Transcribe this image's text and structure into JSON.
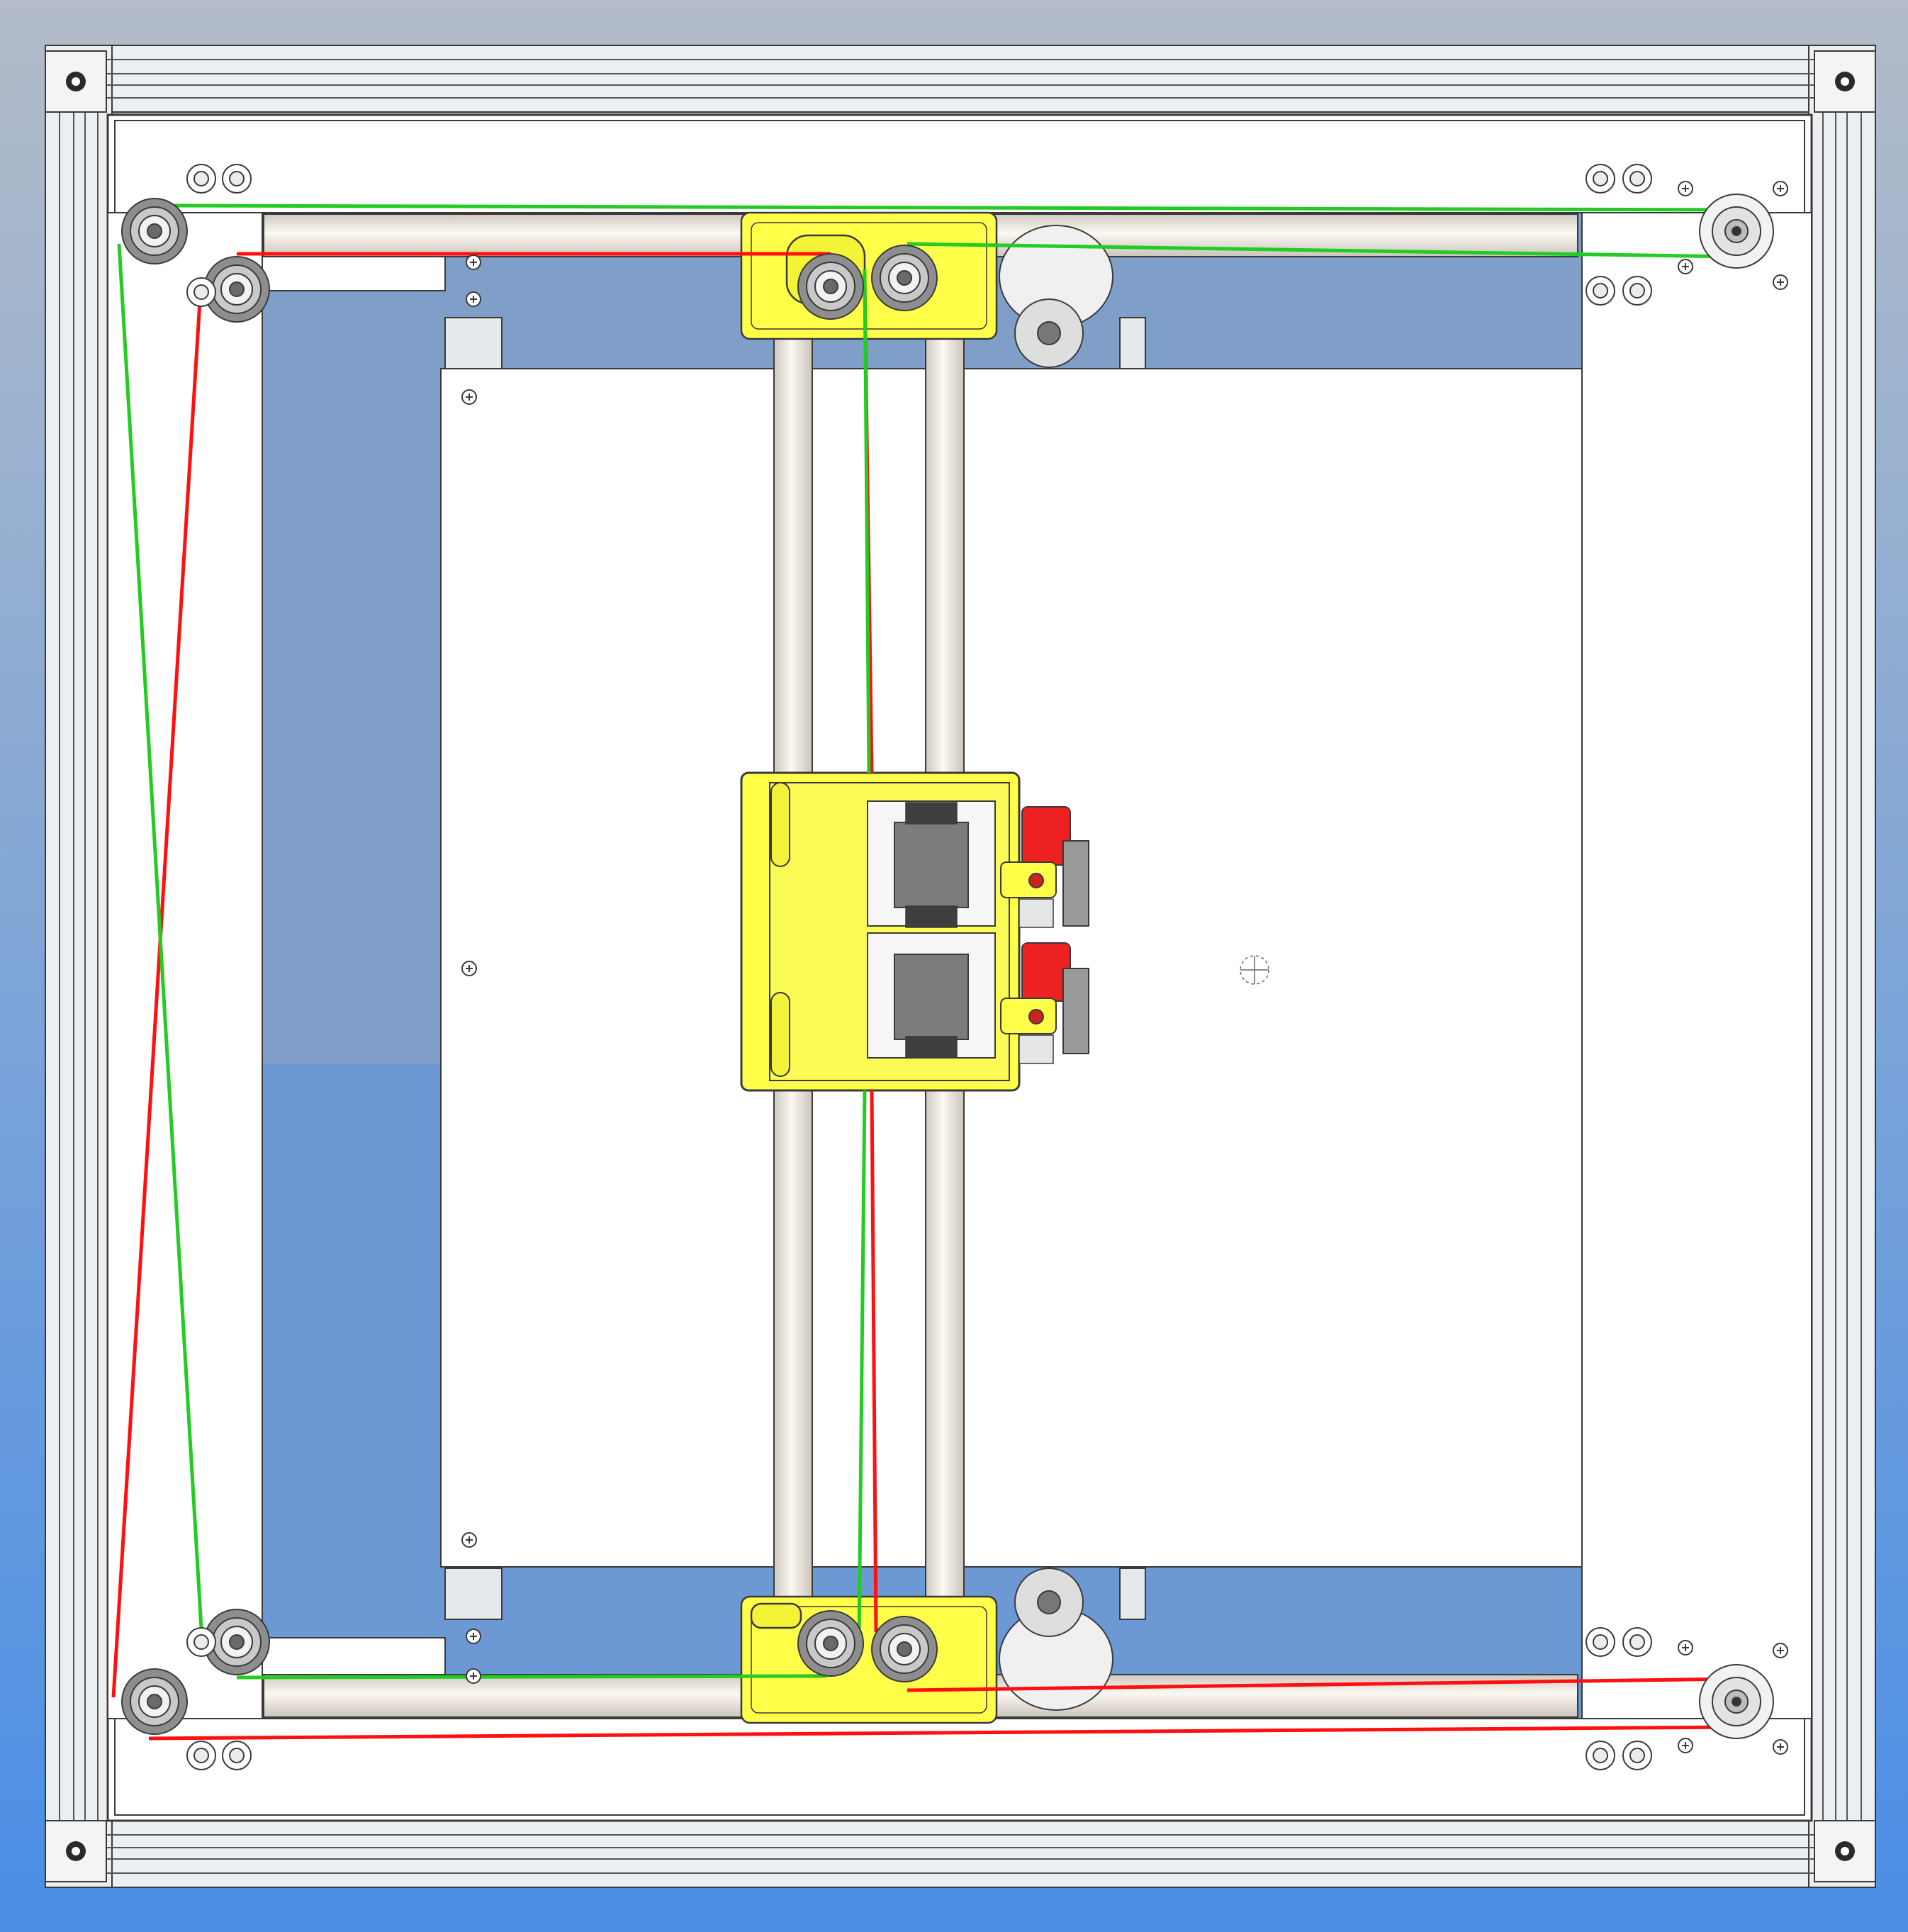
{
  "view": {
    "kind": "CAD top view of a CoreXY gantry frame (no printed text)",
    "background_top": "#b3bcc8",
    "background_bottom": "#4a8ee6"
  },
  "colors": {
    "frame_aluminum": "#e8ebee",
    "plate": "#ffffff",
    "carriage_yellow": "#ffff4a",
    "outline": "#3a3a3a",
    "rod": "#eeeae2",
    "motor_gray": "#7c7c7c",
    "clip_red": "#ee2222",
    "belt_red": "#ff1010",
    "belt_green": "#22cc22",
    "idler_gray": "#8e8e8e"
  },
  "icons": {
    "idler": "pulley-idler-icon",
    "motor_pulley": "gt2-pulley-icon",
    "screw": "screw-head-icon",
    "hole": "mount-hole-icon"
  },
  "belts": [
    {
      "name": "",
      "color_key": "belt_red"
    },
    {
      "name": "",
      "color_key": "belt_green"
    }
  ]
}
